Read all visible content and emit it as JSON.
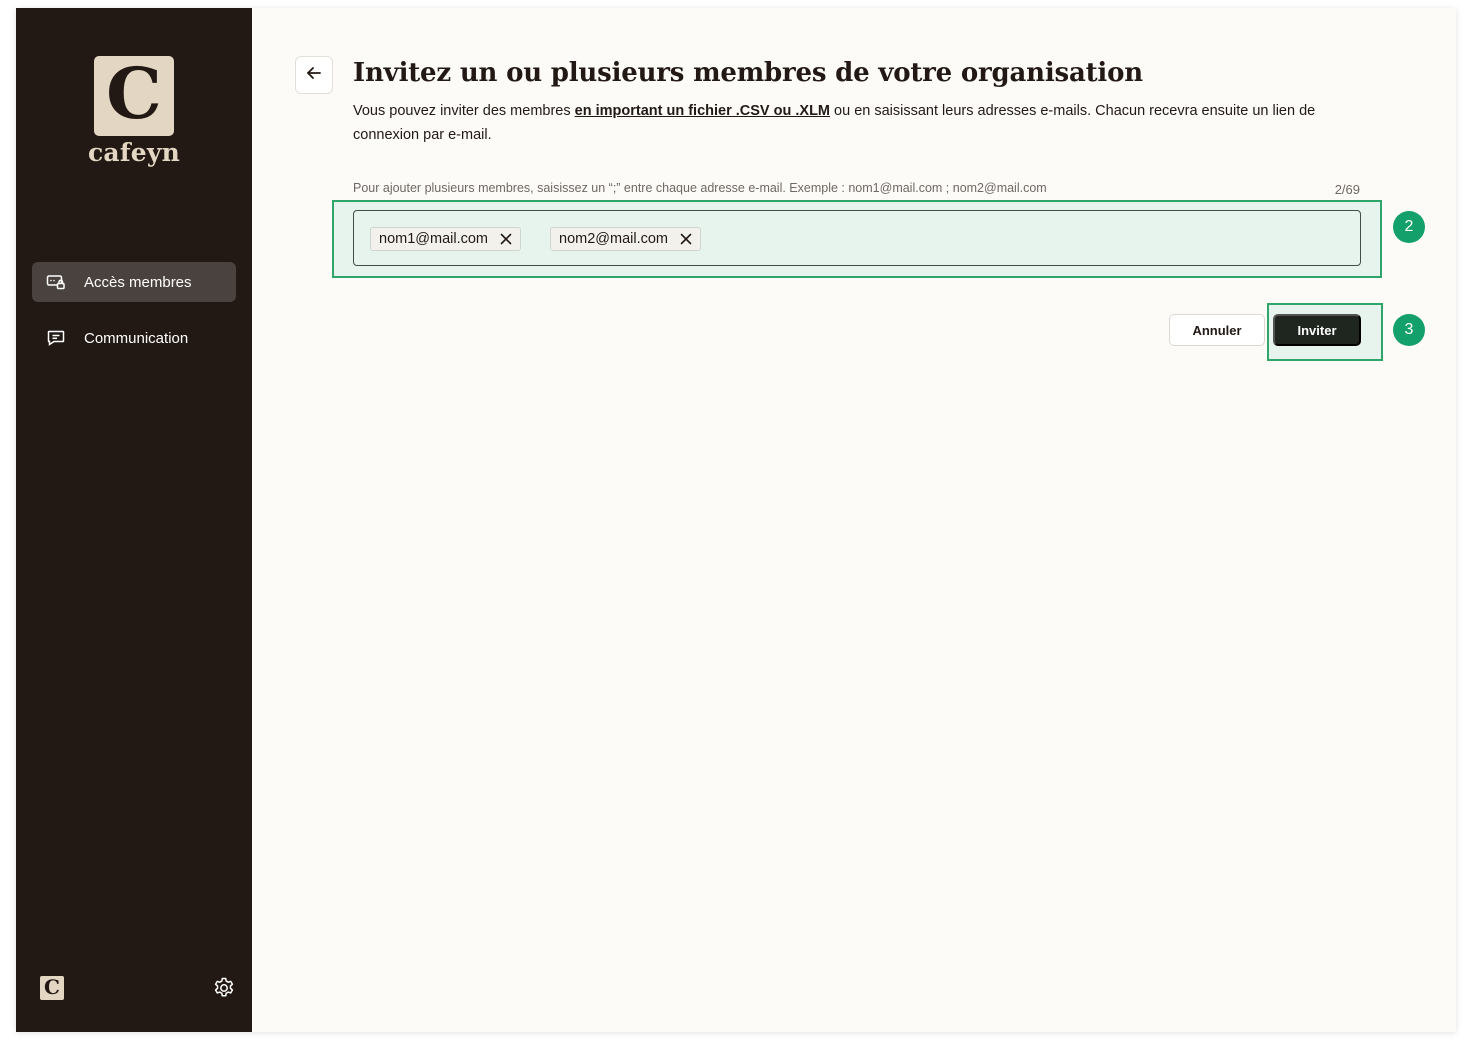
{
  "brand": {
    "logo_letter": "C",
    "name": "cafeyn"
  },
  "sidebar": {
    "items": [
      {
        "label": "Accès membres",
        "icon": "member-access-icon",
        "active": true
      },
      {
        "label": "Communication",
        "icon": "message-icon",
        "active": false
      }
    ],
    "footer": {
      "mini_logo_letter": "C",
      "settings_icon": "gear-icon"
    }
  },
  "page": {
    "back_icon": "arrow-left-icon",
    "title": "Invitez un ou plusieurs membres de votre organisation",
    "description_before": "Vous pouvez inviter des membres ",
    "description_link": "en important un fichier .CSV ou .XLM",
    "description_after": " ou en saisissant leurs adresses e-mails. Chacun recevra ensuite un lien de connexion par e-mail."
  },
  "invite_form": {
    "hint": "Pour ajouter plusieurs membres, saisissez un “;” entre chaque adresse e-mail. Exemple : nom1@mail.com ; nom2@mail.com",
    "counter": "2/69",
    "chips": [
      "nom1@mail.com",
      "nom2@mail.com"
    ],
    "remove_icon": "close-icon"
  },
  "actions": {
    "cancel_label": "Annuler",
    "invite_label": "Inviter"
  },
  "annotations": {
    "step_input": "2",
    "step_button": "3"
  },
  "colors": {
    "sidebar_bg": "#221915",
    "brand_beige": "#e3d6c2",
    "highlight_green": "#2ea56b",
    "step_badge": "#14a06a",
    "primary_button": "#1f251f"
  }
}
